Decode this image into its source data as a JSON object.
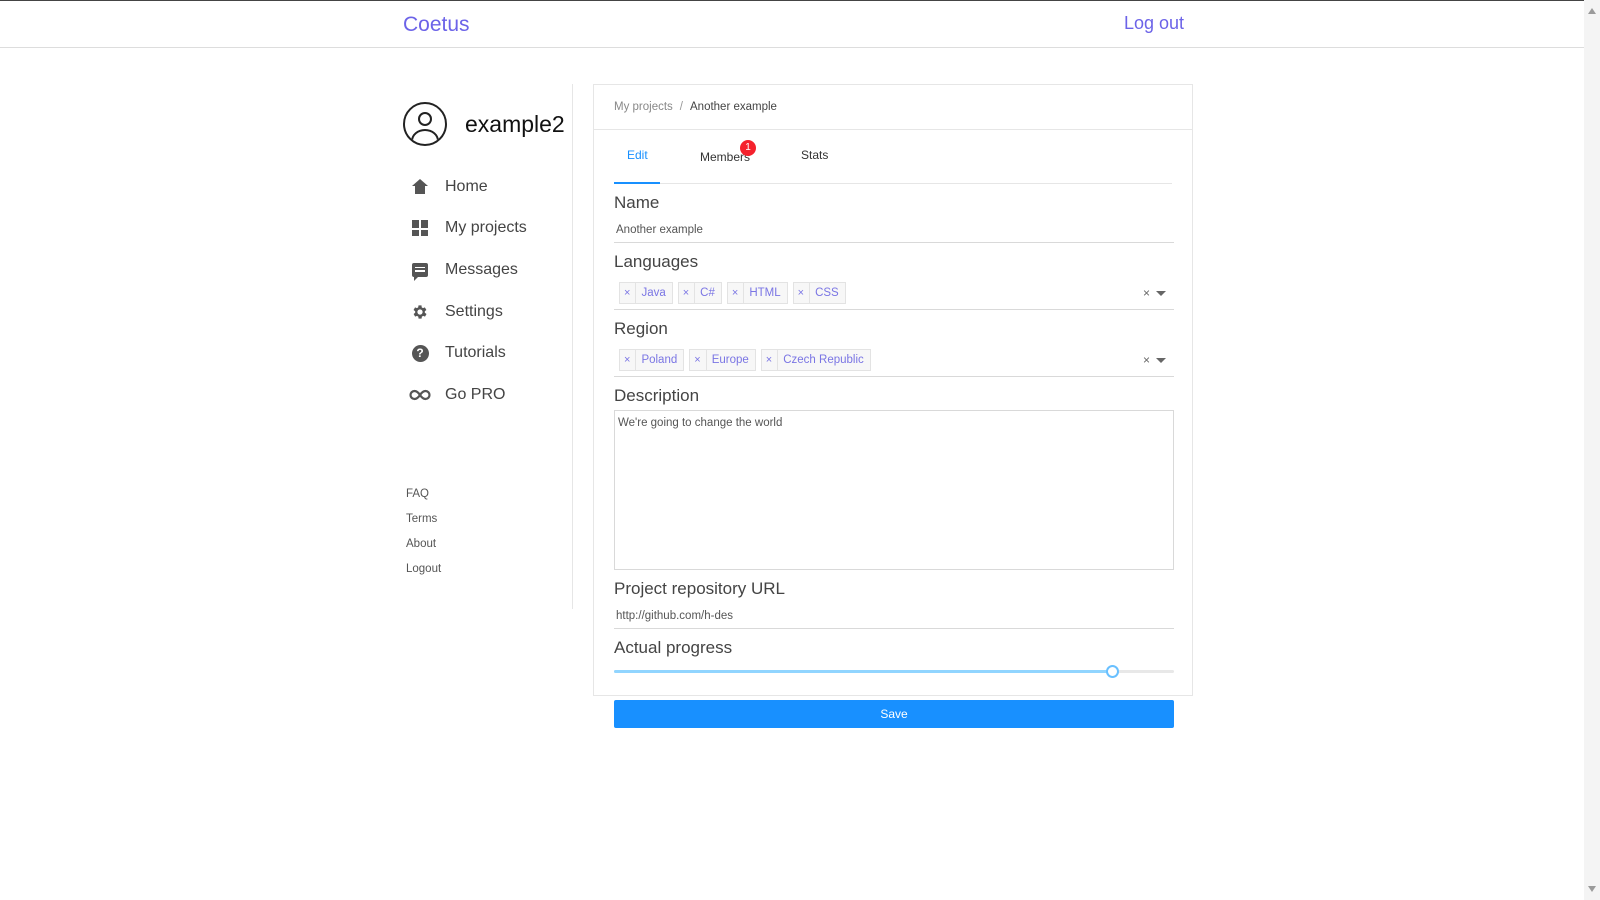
{
  "header": {
    "brand": "Coetus",
    "logout_label": "Log out"
  },
  "user": {
    "name": "example2"
  },
  "sidebar": {
    "nav": [
      {
        "label": "Home",
        "icon": "home-icon"
      },
      {
        "label": "My projects",
        "icon": "dashboard-icon"
      },
      {
        "label": "Messages",
        "icon": "message-icon"
      },
      {
        "label": "Settings",
        "icon": "gear-icon"
      },
      {
        "label": "Tutorials",
        "icon": "question-circle-icon"
      },
      {
        "label": "Go PRO",
        "icon": "infinity-icon"
      }
    ],
    "footer_links": [
      "FAQ",
      "Terms",
      "About",
      "Logout"
    ]
  },
  "breadcrumb": {
    "parent": "My projects",
    "separator": "/",
    "current": "Another example"
  },
  "tabs": {
    "edit": "Edit",
    "members": "Members",
    "members_badge": "1",
    "stats": "Stats",
    "active": "Edit"
  },
  "form": {
    "name_label": "Name",
    "name_value": "Another example",
    "languages_label": "Languages",
    "languages": [
      "Java",
      "C#",
      "HTML",
      "CSS"
    ],
    "region_label": "Region",
    "regions": [
      "Poland",
      "Europe",
      "Czech Republic"
    ],
    "description_label": "Description",
    "description_value": "We're going to change the world",
    "repo_label": "Project repository URL",
    "repo_value": "http://github.com/h-des",
    "progress_label": "Actual progress",
    "progress_percent": 89,
    "save_label": "Save",
    "tag_remove_glyph": "×",
    "clear_glyph": "×"
  },
  "colors": {
    "brand": "#6c63e8",
    "primary": "#1890ff",
    "badge": "#f5222d"
  }
}
